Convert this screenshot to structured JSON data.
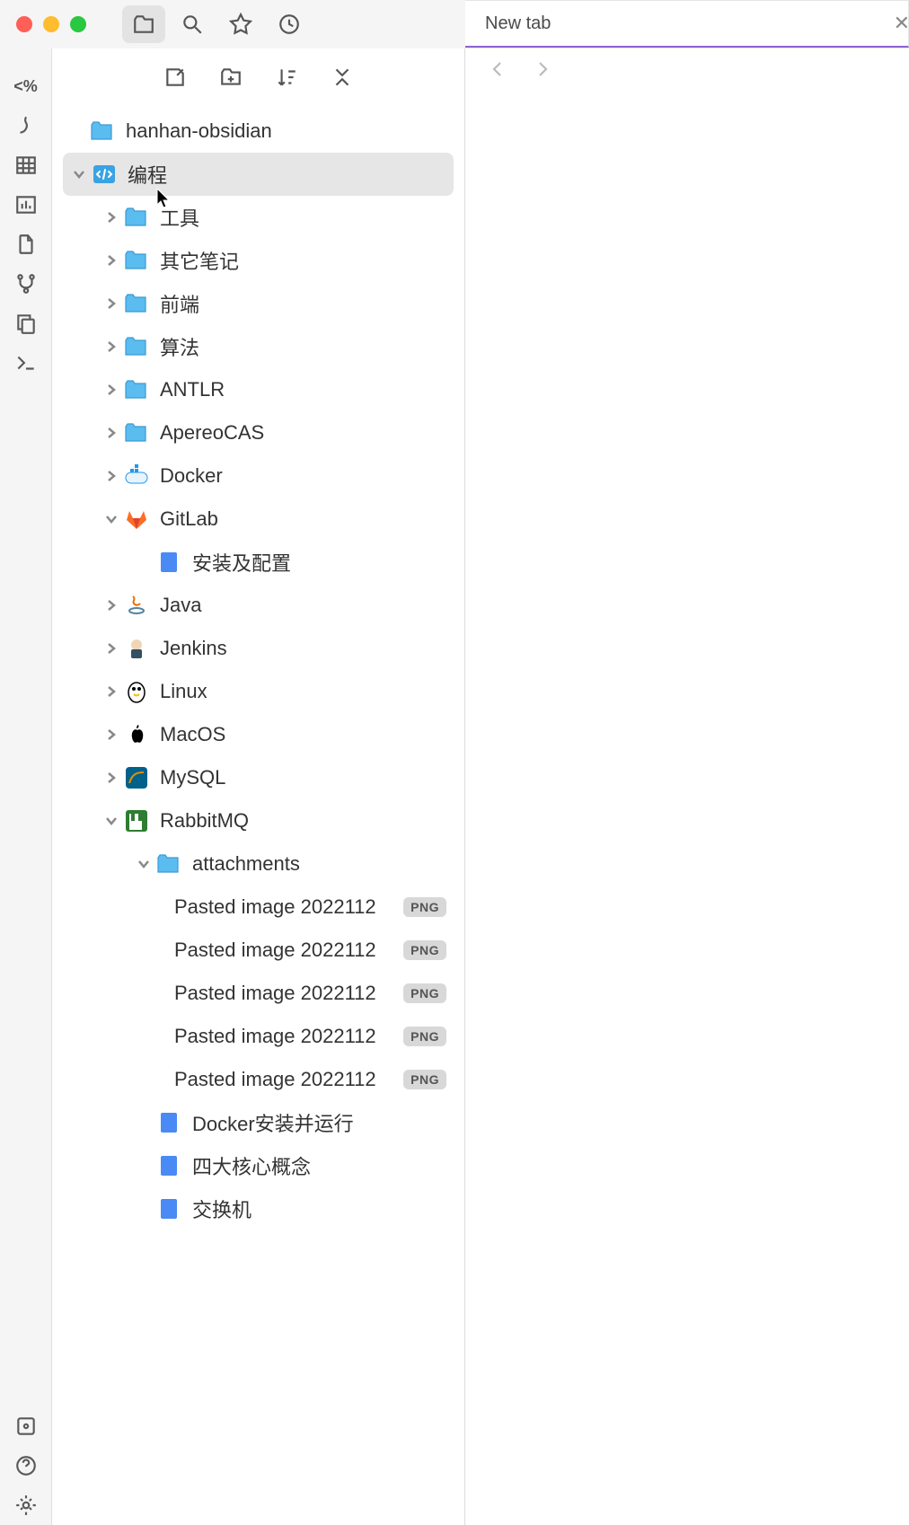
{
  "titlebar": {
    "window_controls": [
      "close",
      "minimize",
      "zoom"
    ],
    "buttons": [
      {
        "name": "files-icon",
        "active": true
      },
      {
        "name": "search-icon",
        "active": false
      },
      {
        "name": "star-icon",
        "active": false
      },
      {
        "name": "clock-icon",
        "active": false
      }
    ],
    "sidebar_toggle_icon": "sidebar-toggle-icon"
  },
  "ribbon": {
    "top": [
      {
        "name": "template-icon",
        "glyph": "<%"
      },
      {
        "name": "draw-icon"
      },
      {
        "name": "table-icon"
      },
      {
        "name": "bar-chart-icon"
      },
      {
        "name": "file-diff-icon"
      },
      {
        "name": "branch-icon"
      },
      {
        "name": "copy-icon"
      },
      {
        "name": "terminal-icon"
      }
    ],
    "bottom": [
      {
        "name": "vault-icon"
      },
      {
        "name": "help-icon"
      },
      {
        "name": "settings-icon"
      }
    ]
  },
  "panel": {
    "toolbar": [
      {
        "name": "new-note-icon"
      },
      {
        "name": "new-folder-icon"
      },
      {
        "name": "sort-icon"
      },
      {
        "name": "collapse-icon"
      }
    ],
    "vault_name": "hanhan-obsidian",
    "tree": [
      {
        "depth": 1,
        "type": "folder",
        "name": "编程",
        "icon": "code-folder",
        "expanded": true,
        "selected": true
      },
      {
        "depth": 2,
        "type": "folder",
        "name": "工具",
        "icon": "folder",
        "expanded": false
      },
      {
        "depth": 2,
        "type": "folder",
        "name": "其它笔记",
        "icon": "folder",
        "expanded": false
      },
      {
        "depth": 2,
        "type": "folder",
        "name": "前端",
        "icon": "folder",
        "expanded": false
      },
      {
        "depth": 2,
        "type": "folder",
        "name": "算法",
        "icon": "folder",
        "expanded": false
      },
      {
        "depth": 2,
        "type": "folder",
        "name": "ANTLR",
        "icon": "folder",
        "expanded": false
      },
      {
        "depth": 2,
        "type": "folder",
        "name": "ApereoCAS",
        "icon": "folder",
        "expanded": false
      },
      {
        "depth": 2,
        "type": "folder",
        "name": "Docker",
        "icon": "docker",
        "expanded": false
      },
      {
        "depth": 2,
        "type": "folder",
        "name": "GitLab",
        "icon": "gitlab",
        "expanded": true
      },
      {
        "depth": 3,
        "type": "note",
        "name": "安装及配置",
        "icon": "doc"
      },
      {
        "depth": 2,
        "type": "folder",
        "name": "Java",
        "icon": "java",
        "expanded": false
      },
      {
        "depth": 2,
        "type": "folder",
        "name": "Jenkins",
        "icon": "jenkins",
        "expanded": false
      },
      {
        "depth": 2,
        "type": "folder",
        "name": "Linux",
        "icon": "linux",
        "expanded": false
      },
      {
        "depth": 2,
        "type": "folder",
        "name": "MacOS",
        "icon": "apple",
        "expanded": false
      },
      {
        "depth": 2,
        "type": "folder",
        "name": "MySQL",
        "icon": "mysql",
        "expanded": false
      },
      {
        "depth": 2,
        "type": "folder",
        "name": "RabbitMQ",
        "icon": "rabbitmq",
        "expanded": true
      },
      {
        "depth": 3,
        "type": "folder",
        "name": "attachments",
        "icon": "folder",
        "expanded": true
      },
      {
        "depth": 4,
        "type": "file",
        "name": "Pasted image 2022112",
        "ext": "PNG"
      },
      {
        "depth": 4,
        "type": "file",
        "name": "Pasted image 2022112",
        "ext": "PNG"
      },
      {
        "depth": 4,
        "type": "file",
        "name": "Pasted image 2022112",
        "ext": "PNG"
      },
      {
        "depth": 4,
        "type": "file",
        "name": "Pasted image 2022112",
        "ext": "PNG"
      },
      {
        "depth": 4,
        "type": "file",
        "name": "Pasted image 2022112",
        "ext": "PNG"
      },
      {
        "depth": 3,
        "type": "note",
        "name": "Docker安装并运行",
        "icon": "doc"
      },
      {
        "depth": 3,
        "type": "note",
        "name": "四大核心概念",
        "icon": "doc"
      },
      {
        "depth": 3,
        "type": "note",
        "name": "交换机",
        "icon": "doc"
      }
    ]
  },
  "editor": {
    "tabs": [
      {
        "title": "New tab"
      }
    ],
    "nav_back_icon": "arrow-left-icon",
    "nav_forward_icon": "arrow-right-icon"
  },
  "colors": {
    "folder_blue": "#5bbcf0",
    "accent": "#8a63d2",
    "badge_bg": "#d8d8d8"
  }
}
